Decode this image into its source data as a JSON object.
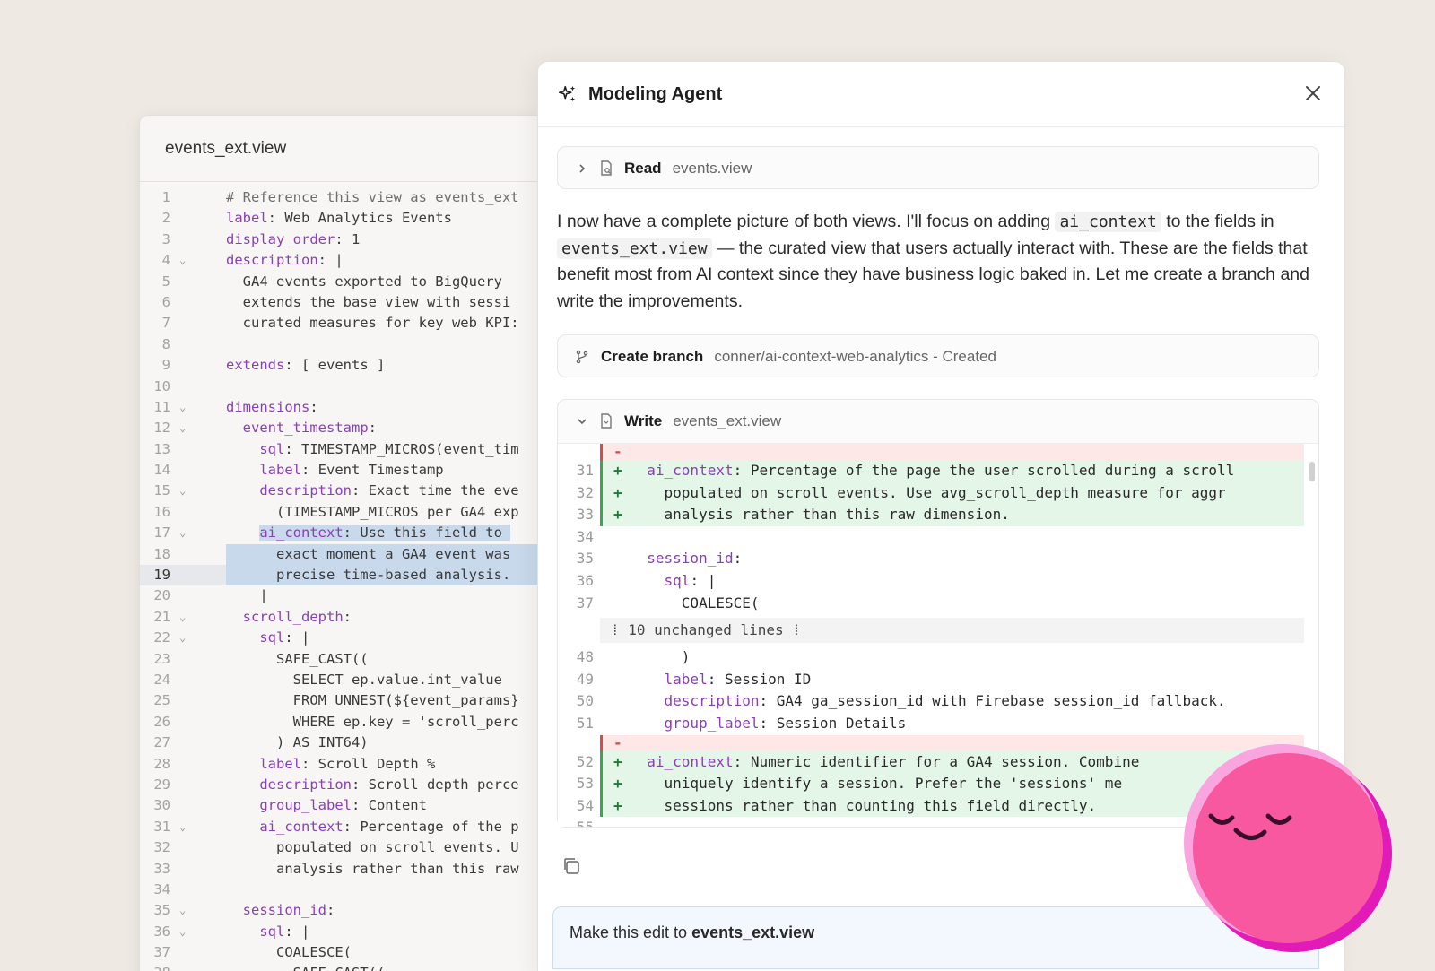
{
  "editor": {
    "filename": "events_ext.view",
    "lines": [
      {
        "n": "1",
        "fold": false,
        "segments": [
          {
            "t": "# Reference this view as events_ext",
            "c": "cm"
          }
        ],
        "indent": 0
      },
      {
        "n": "2",
        "fold": false,
        "segments": [
          {
            "t": "label",
            "c": "key"
          },
          {
            "t": ": Web Analytics Events"
          }
        ]
      },
      {
        "n": "3",
        "fold": false,
        "segments": [
          {
            "t": "display_order",
            "c": "key"
          },
          {
            "t": ": 1"
          }
        ]
      },
      {
        "n": "4",
        "fold": true,
        "segments": [
          {
            "t": "description",
            "c": "key"
          },
          {
            "t": ": |"
          }
        ]
      },
      {
        "n": "5",
        "fold": false,
        "segments": [
          {
            "t": "  GA4 events exported to BigQuery"
          }
        ]
      },
      {
        "n": "6",
        "fold": false,
        "segments": [
          {
            "t": "  extends the base view with sessi"
          }
        ]
      },
      {
        "n": "7",
        "fold": false,
        "segments": [
          {
            "t": "  curated measures for key web KPI:"
          }
        ]
      },
      {
        "n": "8",
        "fold": false,
        "segments": [
          {
            "t": ""
          }
        ]
      },
      {
        "n": "9",
        "fold": false,
        "segments": [
          {
            "t": "extends",
            "c": "key"
          },
          {
            "t": ": [ events ]"
          }
        ]
      },
      {
        "n": "10",
        "fold": false,
        "segments": [
          {
            "t": ""
          }
        ]
      },
      {
        "n": "11",
        "fold": true,
        "segments": [
          {
            "t": "dimensions",
            "c": "key"
          },
          {
            "t": ":"
          }
        ]
      },
      {
        "n": "12",
        "fold": true,
        "segments": [
          {
            "t": "  "
          },
          {
            "t": "event_timestamp",
            "c": "key"
          },
          {
            "t": ":"
          }
        ]
      },
      {
        "n": "13",
        "fold": false,
        "segments": [
          {
            "t": "    "
          },
          {
            "t": "sql",
            "c": "key"
          },
          {
            "t": ": TIMESTAMP_MICROS(event_tim"
          }
        ]
      },
      {
        "n": "14",
        "fold": false,
        "segments": [
          {
            "t": "    "
          },
          {
            "t": "label",
            "c": "key"
          },
          {
            "t": ": Event Timestamp"
          }
        ]
      },
      {
        "n": "15",
        "fold": true,
        "segments": [
          {
            "t": "    "
          },
          {
            "t": "description",
            "c": "key"
          },
          {
            "t": ": Exact time the eve"
          }
        ]
      },
      {
        "n": "16",
        "fold": false,
        "segments": [
          {
            "t": "      (TIMESTAMP_MICROS per GA4 exp"
          }
        ]
      },
      {
        "n": "17",
        "fold": true,
        "segments": [
          {
            "t": "    "
          },
          {
            "t": "ai_context",
            "c": "key hl"
          },
          {
            "t": ": Use this field to ",
            "c": "hl"
          }
        ]
      },
      {
        "n": "18",
        "fold": false,
        "sel": true,
        "segments": [
          {
            "t": "      exact moment a GA4 event was"
          }
        ]
      },
      {
        "n": "19",
        "fold": false,
        "sel": true,
        "cur": true,
        "segments": [
          {
            "t": "      precise time-based analysis."
          }
        ]
      },
      {
        "n": "20",
        "fold": false,
        "segments": [
          {
            "t": "    |"
          }
        ]
      },
      {
        "n": "21",
        "fold": true,
        "segments": [
          {
            "t": "  "
          },
          {
            "t": "scroll_depth",
            "c": "key"
          },
          {
            "t": ":"
          }
        ]
      },
      {
        "n": "22",
        "fold": true,
        "segments": [
          {
            "t": "    "
          },
          {
            "t": "sql",
            "c": "key"
          },
          {
            "t": ": |"
          }
        ]
      },
      {
        "n": "23",
        "fold": false,
        "segments": [
          {
            "t": "      SAFE_CAST(("
          }
        ]
      },
      {
        "n": "24",
        "fold": false,
        "segments": [
          {
            "t": "        SELECT ep.value.int_value"
          }
        ]
      },
      {
        "n": "25",
        "fold": false,
        "segments": [
          {
            "t": "        FROM UNNEST(${event_params}"
          }
        ]
      },
      {
        "n": "26",
        "fold": false,
        "segments": [
          {
            "t": "        WHERE ep.key = 'scroll_perc"
          }
        ]
      },
      {
        "n": "27",
        "fold": false,
        "segments": [
          {
            "t": "      ) AS INT64)"
          }
        ]
      },
      {
        "n": "28",
        "fold": false,
        "segments": [
          {
            "t": "    "
          },
          {
            "t": "label",
            "c": "key"
          },
          {
            "t": ": Scroll Depth %"
          }
        ]
      },
      {
        "n": "29",
        "fold": false,
        "segments": [
          {
            "t": "    "
          },
          {
            "t": "description",
            "c": "key"
          },
          {
            "t": ": Scroll depth perce"
          }
        ]
      },
      {
        "n": "30",
        "fold": false,
        "segments": [
          {
            "t": "    "
          },
          {
            "t": "group_label",
            "c": "key"
          },
          {
            "t": ": Content"
          }
        ]
      },
      {
        "n": "31",
        "fold": true,
        "segments": [
          {
            "t": "    "
          },
          {
            "t": "ai_context",
            "c": "key"
          },
          {
            "t": ": Percentage of the p"
          }
        ]
      },
      {
        "n": "32",
        "fold": false,
        "segments": [
          {
            "t": "      populated on scroll events. U"
          }
        ]
      },
      {
        "n": "33",
        "fold": false,
        "segments": [
          {
            "t": "      analysis rather than this raw"
          }
        ]
      },
      {
        "n": "34",
        "fold": false,
        "segments": [
          {
            "t": ""
          }
        ]
      },
      {
        "n": "35",
        "fold": true,
        "segments": [
          {
            "t": "  "
          },
          {
            "t": "session_id",
            "c": "key"
          },
          {
            "t": ":"
          }
        ]
      },
      {
        "n": "36",
        "fold": true,
        "segments": [
          {
            "t": "    "
          },
          {
            "t": "sql",
            "c": "key"
          },
          {
            "t": ": |"
          }
        ]
      },
      {
        "n": "37",
        "fold": false,
        "segments": [
          {
            "t": "      COALESCE("
          }
        ]
      },
      {
        "n": "38",
        "fold": false,
        "segments": [
          {
            "t": "        SAFE_CAST(("
          }
        ]
      }
    ]
  },
  "panel": {
    "title": "Modeling Agent",
    "read": {
      "verb": "Read",
      "arg": "events.view"
    },
    "message_parts": [
      {
        "t": "I now have a complete picture of both views. I'll focus on adding "
      },
      {
        "t": "ai_context",
        "code": true
      },
      {
        "t": " to the fields in "
      },
      {
        "t": "events_ext.view",
        "code": true
      },
      {
        "t": " — the curated view that users actually interact with. These are the fields that benefit most from AI context since they have business logic baked in. Let me create a branch and write the improvements."
      }
    ],
    "branch": {
      "verb": "Create branch",
      "arg": "conner/ai-context-web-analytics - Created"
    },
    "write": {
      "verb": "Write",
      "arg": "events_ext.view"
    },
    "diff": [
      {
        "type": "del",
        "n": "",
        "m": "-",
        "segments": []
      },
      {
        "type": "add",
        "n": "31",
        "m": "+",
        "segments": [
          {
            "t": "  "
          },
          {
            "t": "ai_context",
            "c": "k2"
          },
          {
            "t": ": Percentage of the page the user scrolled during a scroll"
          }
        ]
      },
      {
        "type": "add",
        "n": "32",
        "m": "+",
        "segments": [
          {
            "t": "    populated on scroll events. Use avg_scroll_depth measure for aggr"
          }
        ]
      },
      {
        "type": "add",
        "n": "33",
        "m": "+",
        "segments": [
          {
            "t": "    analysis rather than this raw dimension."
          }
        ]
      },
      {
        "type": "ctx",
        "n": "34",
        "segments": [
          {
            "t": ""
          }
        ]
      },
      {
        "type": "ctx",
        "n": "35",
        "segments": [
          {
            "t": "  "
          },
          {
            "t": "session_id",
            "c": "k2"
          },
          {
            "t": ":"
          }
        ]
      },
      {
        "type": "ctx",
        "n": "36",
        "segments": [
          {
            "t": "    "
          },
          {
            "t": "sql",
            "c": "k2"
          },
          {
            "t": ": |"
          }
        ]
      },
      {
        "type": "ctx",
        "n": "37",
        "segments": [
          {
            "t": "      COALESCE("
          }
        ]
      },
      {
        "type": "fold",
        "text": "⁞ 10 unchanged lines ⁞"
      },
      {
        "type": "ctx",
        "n": "48",
        "segments": [
          {
            "t": "      )"
          }
        ]
      },
      {
        "type": "ctx",
        "n": "49",
        "segments": [
          {
            "t": "    "
          },
          {
            "t": "label",
            "c": "k2"
          },
          {
            "t": ": Session ID"
          }
        ]
      },
      {
        "type": "ctx",
        "n": "50",
        "segments": [
          {
            "t": "    "
          },
          {
            "t": "description",
            "c": "k2"
          },
          {
            "t": ": GA4 ga_session_id with Firebase session_id fallback."
          }
        ]
      },
      {
        "type": "ctx",
        "n": "51",
        "segments": [
          {
            "t": "    "
          },
          {
            "t": "group_label",
            "c": "k2"
          },
          {
            "t": ": Session Details"
          }
        ]
      },
      {
        "type": "del",
        "n": "",
        "m": "-",
        "segments": []
      },
      {
        "type": "add",
        "n": "52",
        "m": "+",
        "segments": [
          {
            "t": "  "
          },
          {
            "t": "ai_context",
            "c": "k2"
          },
          {
            "t": ": Numeric identifier for a GA4 session. Combine"
          }
        ]
      },
      {
        "type": "add",
        "n": "53",
        "m": "+",
        "segments": [
          {
            "t": "    uniquely identify a session. Prefer the 'sessions' me"
          }
        ]
      },
      {
        "type": "add",
        "n": "54",
        "m": "+",
        "segments": [
          {
            "t": "    sessions rather than counting this field directly."
          }
        ]
      },
      {
        "type": "ctx",
        "n": "55",
        "segments": [
          {
            "t": ""
          }
        ]
      }
    ],
    "prompt_prefix": "Make this edit to ",
    "prompt_file": "events_ext.view"
  },
  "icon_names": [
    "sparkle-icon",
    "close-icon",
    "chevron-right-icon",
    "file-search-icon",
    "git-branch-icon",
    "chevron-down-icon",
    "file-icon",
    "copy-icon",
    "chevron-down-fold-icon"
  ],
  "colors": {
    "background": "#efe9e3",
    "keyword": "#8a3fb8",
    "added": "#e3f6e7",
    "removed": "#fde7e7",
    "mascot": "#f7589f"
  }
}
